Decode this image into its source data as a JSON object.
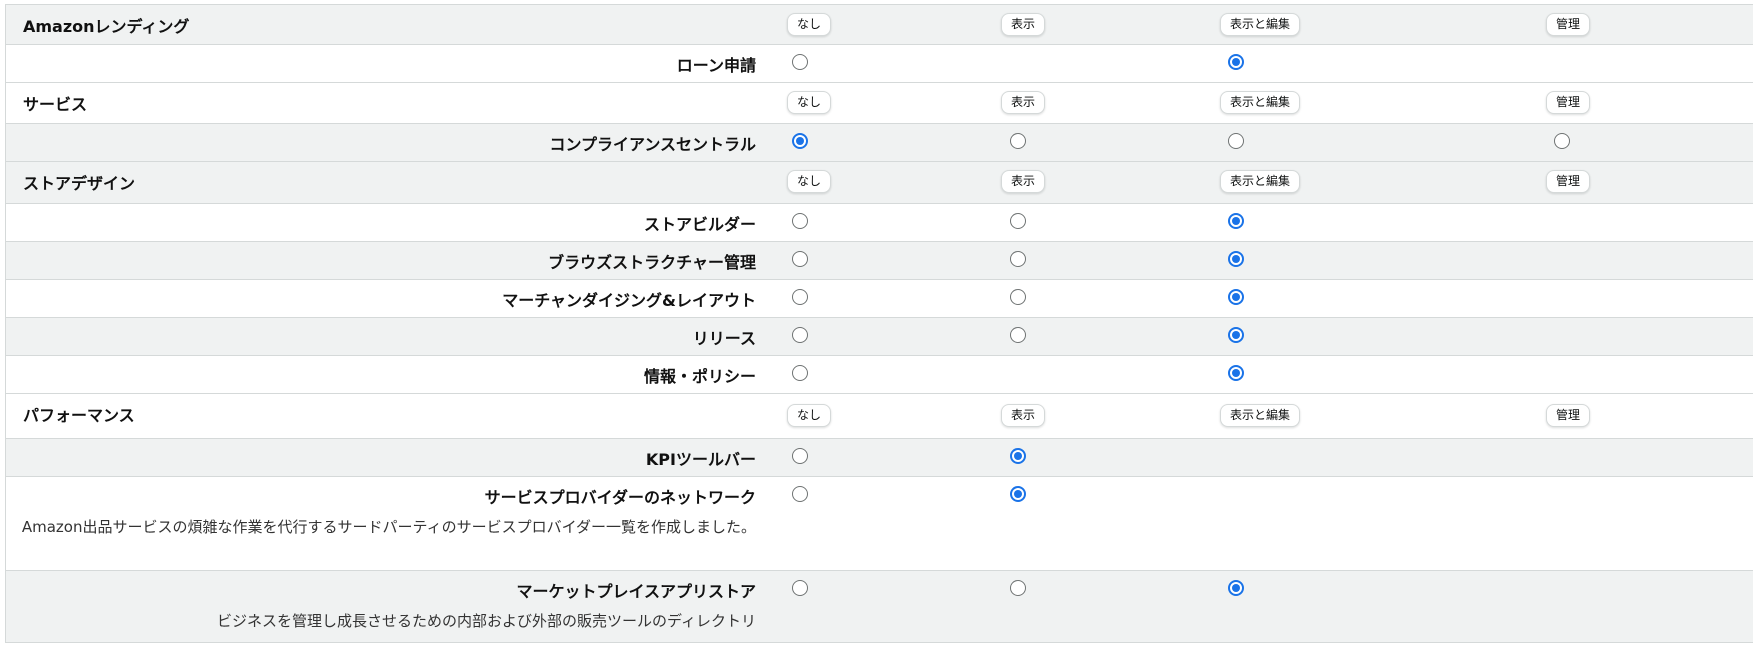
{
  "column_labels": {
    "none": "なし",
    "view": "表示",
    "view_edit": "表示と編集",
    "admin": "管理"
  },
  "groups": [
    {
      "title": "Amazonレンディング",
      "permissions": [
        {
          "name": "ローン申請",
          "options": [
            "none",
            "view_edit"
          ],
          "selected": "view_edit"
        }
      ]
    },
    {
      "title": "サービス",
      "permissions": [
        {
          "name": "コンプライアンスセントラル",
          "options": [
            "none",
            "view",
            "view_edit",
            "admin"
          ],
          "selected": "none"
        }
      ]
    },
    {
      "title": "ストアデザイン",
      "permissions": [
        {
          "name": "ストアビルダー",
          "options": [
            "none",
            "view",
            "view_edit"
          ],
          "selected": "view_edit"
        },
        {
          "name": "ブラウズストラクチャー管理",
          "options": [
            "none",
            "view",
            "view_edit"
          ],
          "selected": "view_edit"
        },
        {
          "name": "マーチャンダイジング&レイアウト",
          "options": [
            "none",
            "view",
            "view_edit"
          ],
          "selected": "view_edit"
        },
        {
          "name": "リリース",
          "options": [
            "none",
            "view",
            "view_edit"
          ],
          "selected": "view_edit"
        },
        {
          "name": "情報・ポリシー",
          "options": [
            "none",
            "view_edit"
          ],
          "selected": "view_edit"
        }
      ]
    },
    {
      "title": "パフォーマンス",
      "permissions": [
        {
          "name": "KPIツールバー",
          "options": [
            "none",
            "view"
          ],
          "selected": "view"
        },
        {
          "name": "サービスプロバイダーのネットワーク",
          "description": "Amazon出品サービスの煩雑な作業を代行するサードパーティのサービスプロバイダー一覧を作成しました。",
          "options": [
            "none",
            "view"
          ],
          "selected": "view"
        },
        {
          "name": "マーケットプレイスアプリストア",
          "description": "ビジネスを管理し成長させるための内部および外部の販売ツールのディレクトリ",
          "options": [
            "none",
            "view",
            "view_edit"
          ],
          "selected": "view_edit"
        }
      ]
    }
  ]
}
